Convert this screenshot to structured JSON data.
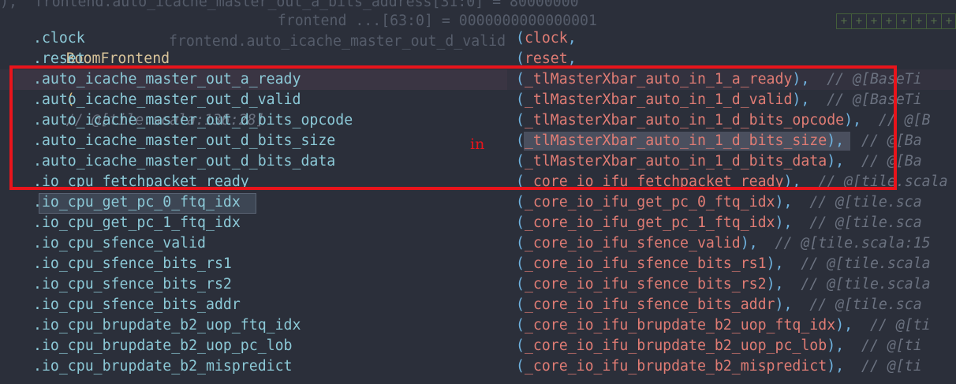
{
  "ghost_lines": [
    "),  frontend.auto_icache_master_out_a_bits_address[31:0] = 80000000",
    "    frontend ...[63:0] = 0000000000000001",
    "frontend.auto_icache_master_out_d_valid"
  ],
  "header": {
    "module": "BoomFrontend",
    "instance": "frontend",
    "open_paren": "(",
    "comment": "// @[tile.scala:136:28]"
  },
  "rows": [
    {
      "port": ".clock",
      "signal": "clock",
      "trail": ",",
      "comment": ""
    },
    {
      "port": ".reset",
      "signal": "reset",
      "trail": ",",
      "comment": ""
    },
    {
      "port": ".auto_icache_master_out_a_ready",
      "signal": "_tlMasterXbar_auto_in_1_a_ready",
      "trail": "),",
      "comment": "// @[BaseTi"
    },
    {
      "port": ".auto_icache_master_out_d_valid",
      "signal": "_tlMasterXbar_auto_in_1_d_valid",
      "trail": "),",
      "comment": "// @[BaseTi"
    },
    {
      "port": ".auto_icache_master_out_d_bits_opcode",
      "signal": "_tlMasterXbar_auto_in_1_d_bits_opcode",
      "trail": "),",
      "comment": "// @[B"
    },
    {
      "port": ".auto_icache_master_out_d_bits_size",
      "signal": "_tlMasterXbar_auto_in_1_d_bits_size",
      "trail": "),",
      "comment": "// @[Ba"
    },
    {
      "port": ".auto_icache_master_out_d_bits_data",
      "signal": "_tlMasterXbar_auto_in_1_d_bits_data",
      "trail": "),",
      "comment": "// @[Ba"
    },
    {
      "port": ".io_cpu_fetchpacket_ready",
      "signal": "_core_io_ifu_fetchpacket_ready",
      "trail": "),",
      "comment": "// @[tile.scala"
    },
    {
      "port": ".io_cpu_get_pc_0_ftq_idx",
      "signal": "_core_io_ifu_get_pc_0_ftq_idx",
      "trail": "),",
      "comment": "// @[tile.sca"
    },
    {
      "port": ".io_cpu_get_pc_1_ftq_idx",
      "signal": "_core_io_ifu_get_pc_1_ftq_idx",
      "trail": "),",
      "comment": "// @[tile.sca"
    },
    {
      "port": ".io_cpu_sfence_valid",
      "signal": "_core_io_ifu_sfence_valid",
      "trail": "),",
      "comment": "// @[tile.scala:15"
    },
    {
      "port": ".io_cpu_sfence_bits_rs1",
      "signal": "_core_io_ifu_sfence_bits_rs1",
      "trail": "),",
      "comment": "// @[tile.scala"
    },
    {
      "port": ".io_cpu_sfence_bits_rs2",
      "signal": "_core_io_ifu_sfence_bits_rs2",
      "trail": "),",
      "comment": "// @[tile.scala"
    },
    {
      "port": ".io_cpu_sfence_bits_addr",
      "signal": "_core_io_ifu_sfence_bits_addr",
      "trail": "),",
      "comment": "// @[tile.sca"
    },
    {
      "port": ".io_cpu_brupdate_b2_uop_ftq_idx",
      "signal": "_core_io_ifu_brupdate_b2_uop_ftq_idx",
      "trail": "),",
      "comment": "// @[ti"
    },
    {
      "port": ".io_cpu_brupdate_b2_uop_pc_lob",
      "signal": "_core_io_ifu_brupdate_b2_uop_pc_lob",
      "trail": "),",
      "comment": "// @[ti"
    },
    {
      "port": ".io_cpu_brupdate_b2_mispredict",
      "signal": "_core_io_ifu_brupdate_b2_mispredict",
      "trail": "),",
      "comment": "// @[ti"
    }
  ],
  "annotation": {
    "label": "in",
    "color": "#e8141b"
  },
  "colors": {
    "background": "#2b2f3a",
    "port": "#8cc9d7",
    "signal": "#e07c74",
    "paren": "#6fb3e0",
    "comment": "#6b7280"
  }
}
